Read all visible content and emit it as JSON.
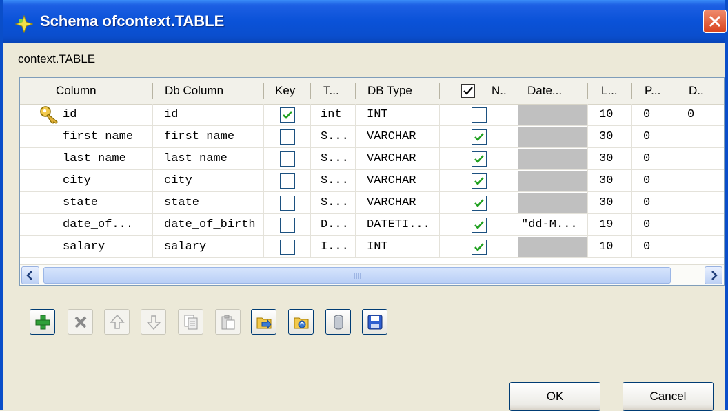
{
  "window": {
    "title": "Schema ofcontext.TABLE"
  },
  "context_label": "context.TABLE",
  "columns": [
    "Column",
    "Db Column",
    "Key",
    "T...",
    "DB Type",
    "N..",
    "Date...",
    "L...",
    "P...",
    "D.."
  ],
  "rows": [
    {
      "column": "id",
      "db_column": "id",
      "key": true,
      "type": "int",
      "db_type": "INT",
      "nullable": false,
      "date_pattern": "",
      "length": "10",
      "precision": "0",
      "default": "0"
    },
    {
      "column": "first_name",
      "db_column": "first_name",
      "key": false,
      "type": "S...",
      "db_type": "VARCHAR",
      "nullable": true,
      "date_pattern": "",
      "length": "30",
      "precision": "0",
      "default": ""
    },
    {
      "column": "last_name",
      "db_column": "last_name",
      "key": false,
      "type": "S...",
      "db_type": "VARCHAR",
      "nullable": true,
      "date_pattern": "",
      "length": "30",
      "precision": "0",
      "default": ""
    },
    {
      "column": "city",
      "db_column": "city",
      "key": false,
      "type": "S...",
      "db_type": "VARCHAR",
      "nullable": true,
      "date_pattern": "",
      "length": "30",
      "precision": "0",
      "default": ""
    },
    {
      "column": "state",
      "db_column": "state",
      "key": false,
      "type": "S...",
      "db_type": "VARCHAR",
      "nullable": true,
      "date_pattern": "",
      "length": "30",
      "precision": "0",
      "default": ""
    },
    {
      "column": "date_of...",
      "db_column": "date_of_birth",
      "key": false,
      "type": "D...",
      "db_type": "DATETI...",
      "nullable": true,
      "date_pattern": "\"dd-M...",
      "length": "19",
      "precision": "0",
      "default": ""
    },
    {
      "column": "salary",
      "db_column": "salary",
      "key": false,
      "type": "I...",
      "db_type": "INT",
      "nullable": true,
      "date_pattern": "",
      "length": "10",
      "precision": "0",
      "default": ""
    }
  ],
  "buttons": {
    "ok": "OK",
    "cancel": "Cancel"
  },
  "toolbar": [
    {
      "icon": "add-icon",
      "enabled": true
    },
    {
      "icon": "delete-icon",
      "enabled": false
    },
    {
      "icon": "move-up-icon",
      "enabled": false
    },
    {
      "icon": "move-down-icon",
      "enabled": false
    },
    {
      "icon": "copy-icon",
      "enabled": false
    },
    {
      "icon": "paste-icon",
      "enabled": false
    },
    {
      "icon": "import-icon",
      "enabled": true
    },
    {
      "icon": "export-icon",
      "enabled": true
    },
    {
      "icon": "database-icon",
      "enabled": true
    },
    {
      "icon": "save-icon",
      "enabled": true
    }
  ],
  "colors": {
    "titlebar": "#0a52d8",
    "check": "#21a121",
    "grey_cell": "#c0c0c0"
  }
}
